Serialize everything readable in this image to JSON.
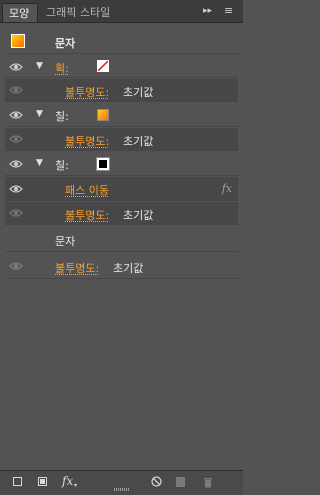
{
  "tabs": [
    {
      "label": "모양"
    },
    {
      "label": "그래픽 스타일"
    }
  ],
  "tab_controls": {
    "collapse": "▸▸",
    "menu": "≡"
  },
  "header": {
    "title": "문자"
  },
  "rows": {
    "stroke1": {
      "label": "획:"
    },
    "stroke1_opacity": {
      "key": "불투명도:",
      "value": "초기값"
    },
    "fill1": {
      "label": "칠:"
    },
    "fill1_opacity": {
      "key": "불투명도:",
      "value": "초기값"
    },
    "fill2": {
      "label": "칠:"
    },
    "path_offset": {
      "label": "패스 이동",
      "fx": "fx"
    },
    "fill2_opacity": {
      "key": "불투명도:",
      "value": "초기값"
    },
    "chars": {
      "label": "문자"
    },
    "chars_opacity": {
      "key": "불투명도:",
      "value": "초기값"
    }
  },
  "toolbar": {
    "fx_label": "fx"
  },
  "colors": {
    "accent_orange": "#f7a02d",
    "gradient_start": "#ffd21a",
    "gradient_end": "#ff6a00",
    "panel_bg": "#535353"
  }
}
